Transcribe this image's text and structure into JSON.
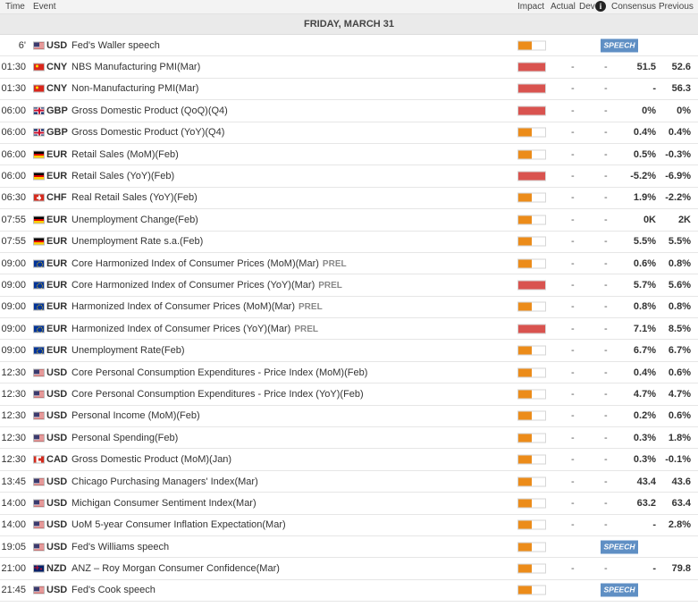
{
  "colors": {
    "impact_high": "#d9534f",
    "impact_med": "#ec8c1a",
    "impact_empty": "#ffffff",
    "speech_badge": "#5f8fc4"
  },
  "header": {
    "time": "Time",
    "event": "Event",
    "impact": "Impact",
    "actual": "Actual",
    "dev": "Dev",
    "info_icon": "i",
    "consensus": "Consensus",
    "previous": "Previous"
  },
  "date_label": "FRIDAY, MARCH 31",
  "rows": [
    {
      "time": "6'",
      "flag": "us",
      "cur": "USD",
      "event": "Fed's Waller speech",
      "impact": "med",
      "actual": "",
      "dev": "",
      "cons": "",
      "prev": "",
      "speech": "SPEECH"
    },
    {
      "time": "01:30",
      "flag": "cn",
      "cur": "CNY",
      "event": "NBS Manufacturing PMI(Mar)",
      "impact": "high",
      "actual": "-",
      "dev": "-",
      "cons": "51.5",
      "prev": "52.6"
    },
    {
      "time": "01:30",
      "flag": "cn",
      "cur": "CNY",
      "event": "Non-Manufacturing PMI(Mar)",
      "impact": "high",
      "actual": "-",
      "dev": "-",
      "cons": "-",
      "prev": "56.3"
    },
    {
      "time": "06:00",
      "flag": "gb",
      "cur": "GBP",
      "event": "Gross Domestic Product (QoQ)(Q4)",
      "impact": "high",
      "actual": "-",
      "dev": "-",
      "cons": "0%",
      "prev": "0%"
    },
    {
      "time": "06:00",
      "flag": "gb",
      "cur": "GBP",
      "event": "Gross Domestic Product (YoY)(Q4)",
      "impact": "med",
      "actual": "-",
      "dev": "-",
      "cons": "0.4%",
      "prev": "0.4%"
    },
    {
      "time": "06:00",
      "flag": "de",
      "cur": "EUR",
      "event": "Retail Sales (MoM)(Feb)",
      "impact": "med",
      "actual": "-",
      "dev": "-",
      "cons": "0.5%",
      "prev": "-0.3%"
    },
    {
      "time": "06:00",
      "flag": "de",
      "cur": "EUR",
      "event": "Retail Sales (YoY)(Feb)",
      "impact": "high",
      "actual": "-",
      "dev": "-",
      "cons": "-5.2%",
      "prev": "-6.9%"
    },
    {
      "time": "06:30",
      "flag": "ch",
      "cur": "CHF",
      "event": "Real Retail Sales (YoY)(Feb)",
      "impact": "med",
      "actual": "-",
      "dev": "-",
      "cons": "1.9%",
      "prev": "-2.2%"
    },
    {
      "time": "07:55",
      "flag": "de",
      "cur": "EUR",
      "event": "Unemployment Change(Feb)",
      "impact": "med",
      "actual": "-",
      "dev": "-",
      "cons": "0K",
      "prev": "2K"
    },
    {
      "time": "07:55",
      "flag": "de",
      "cur": "EUR",
      "event": "Unemployment Rate s.a.(Feb)",
      "impact": "med",
      "actual": "-",
      "dev": "-",
      "cons": "5.5%",
      "prev": "5.5%"
    },
    {
      "time": "09:00",
      "flag": "eu",
      "cur": "EUR",
      "event": "Core Harmonized Index of Consumer Prices (MoM)(Mar)",
      "prel": "PREL",
      "impact": "med",
      "actual": "-",
      "dev": "-",
      "cons": "0.6%",
      "prev": "0.8%"
    },
    {
      "time": "09:00",
      "flag": "eu",
      "cur": "EUR",
      "event": "Core Harmonized Index of Consumer Prices (YoY)(Mar)",
      "prel": "PREL",
      "impact": "high",
      "actual": "-",
      "dev": "-",
      "cons": "5.7%",
      "prev": "5.6%"
    },
    {
      "time": "09:00",
      "flag": "eu",
      "cur": "EUR",
      "event": "Harmonized Index of Consumer Prices (MoM)(Mar)",
      "prel": "PREL",
      "impact": "med",
      "actual": "-",
      "dev": "-",
      "cons": "0.8%",
      "prev": "0.8%"
    },
    {
      "time": "09:00",
      "flag": "eu",
      "cur": "EUR",
      "event": "Harmonized Index of Consumer Prices (YoY)(Mar)",
      "prel": "PREL",
      "impact": "high",
      "actual": "-",
      "dev": "-",
      "cons": "7.1%",
      "prev": "8.5%"
    },
    {
      "time": "09:00",
      "flag": "eu",
      "cur": "EUR",
      "event": "Unemployment Rate(Feb)",
      "impact": "med",
      "actual": "-",
      "dev": "-",
      "cons": "6.7%",
      "prev": "6.7%"
    },
    {
      "time": "12:30",
      "flag": "us",
      "cur": "USD",
      "event": "Core Personal Consumption Expenditures - Price Index (MoM)(Feb)",
      "impact": "med",
      "actual": "-",
      "dev": "-",
      "cons": "0.4%",
      "prev": "0.6%"
    },
    {
      "time": "12:30",
      "flag": "us",
      "cur": "USD",
      "event": "Core Personal Consumption Expenditures - Price Index (YoY)(Feb)",
      "impact": "med",
      "actual": "-",
      "dev": "-",
      "cons": "4.7%",
      "prev": "4.7%"
    },
    {
      "time": "12:30",
      "flag": "us",
      "cur": "USD",
      "event": "Personal Income (MoM)(Feb)",
      "impact": "med",
      "actual": "-",
      "dev": "-",
      "cons": "0.2%",
      "prev": "0.6%"
    },
    {
      "time": "12:30",
      "flag": "us",
      "cur": "USD",
      "event": "Personal Spending(Feb)",
      "impact": "med",
      "actual": "-",
      "dev": "-",
      "cons": "0.3%",
      "prev": "1.8%"
    },
    {
      "time": "12:30",
      "flag": "ca",
      "cur": "CAD",
      "event": "Gross Domestic Product (MoM)(Jan)",
      "impact": "med",
      "actual": "-",
      "dev": "-",
      "cons": "0.3%",
      "prev": "-0.1%"
    },
    {
      "time": "13:45",
      "flag": "us",
      "cur": "USD",
      "event": "Chicago Purchasing Managers' Index(Mar)",
      "impact": "med",
      "actual": "-",
      "dev": "-",
      "cons": "43.4",
      "prev": "43.6"
    },
    {
      "time": "14:00",
      "flag": "us",
      "cur": "USD",
      "event": "Michigan Consumer Sentiment Index(Mar)",
      "impact": "med",
      "actual": "-",
      "dev": "-",
      "cons": "63.2",
      "prev": "63.4"
    },
    {
      "time": "14:00",
      "flag": "us",
      "cur": "USD",
      "event": "UoM 5-year Consumer Inflation Expectation(Mar)",
      "impact": "med",
      "actual": "-",
      "dev": "-",
      "cons": "-",
      "prev": "2.8%"
    },
    {
      "time": "19:05",
      "flag": "us",
      "cur": "USD",
      "event": "Fed's Williams speech",
      "impact": "med",
      "actual": "",
      "dev": "",
      "cons": "",
      "prev": "",
      "speech": "SPEECH"
    },
    {
      "time": "21:00",
      "flag": "nz",
      "cur": "NZD",
      "event": "ANZ – Roy Morgan Consumer Confidence(Mar)",
      "impact": "med",
      "actual": "-",
      "dev": "-",
      "cons": "-",
      "prev": "79.8"
    },
    {
      "time": "21:45",
      "flag": "us",
      "cur": "USD",
      "event": "Fed's Cook speech",
      "impact": "med",
      "actual": "",
      "dev": "",
      "cons": "",
      "prev": "",
      "speech": "SPEECH"
    }
  ]
}
